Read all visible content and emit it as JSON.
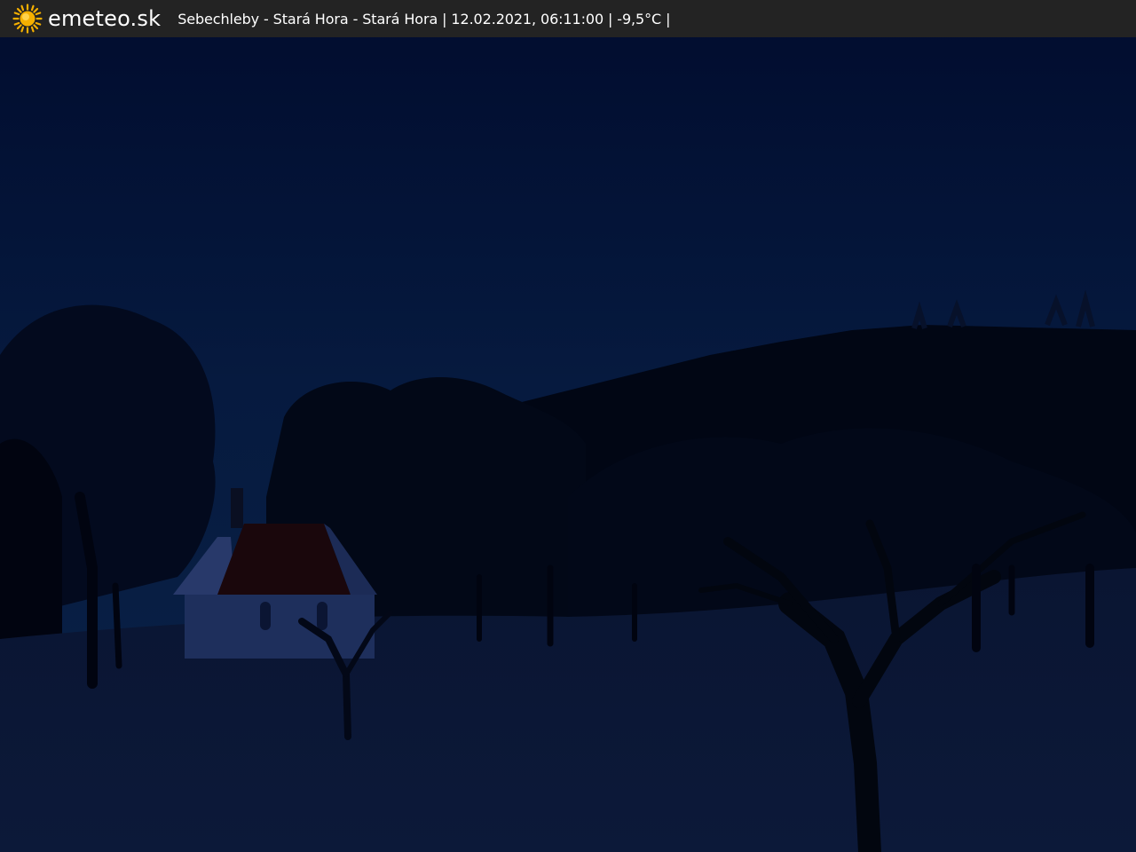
{
  "header": {
    "brand": "emeteo.sk",
    "caption": "Sebechleby - Stará Hora - Stará Hora | 12.02.2021, 06:11:00 | -9,5°C |",
    "logo_icon": "sun-icon"
  },
  "colors": {
    "bar_background": "#232323",
    "brand_text": "#ffffff",
    "sun": "#f5b000",
    "sky": "#061a3f",
    "hill": "#010614",
    "snow": "#0b1836",
    "chapel_wall": "#1e2f5c",
    "chapel_roof": "#1a070c"
  }
}
